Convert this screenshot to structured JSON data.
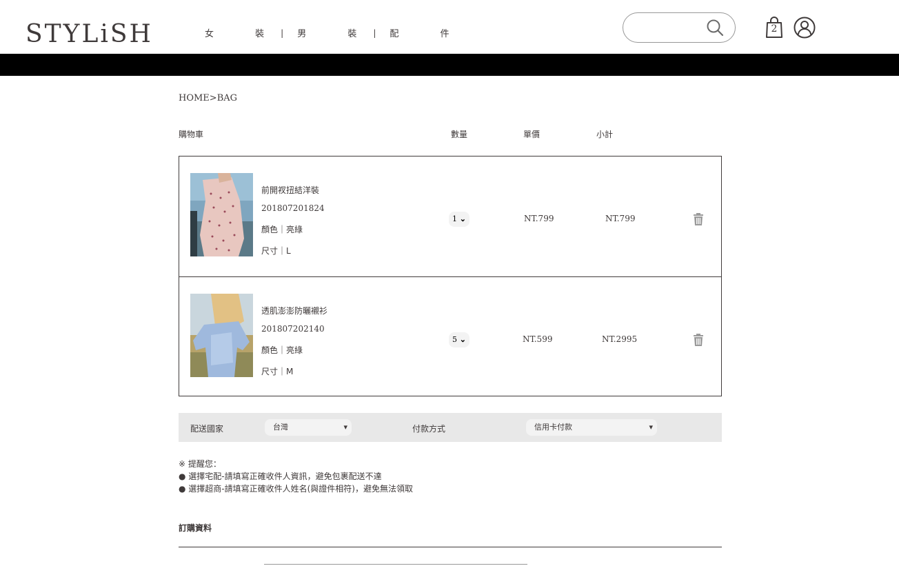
{
  "header": {
    "logo": "STYLiSH",
    "nav": [
      "女 裝",
      "男 裝",
      "配 件"
    ],
    "nav_sep": "|",
    "search_placeholder": "",
    "cart_count": "2"
  },
  "breadcrumb": "HOME>BAG",
  "cart_headers": {
    "title": "購物車",
    "qty": "數量",
    "unit_price": "單價",
    "subtotal": "小計"
  },
  "cart_items": [
    {
      "name": "前開衩扭結洋裝",
      "id": "201807201824",
      "color": "顏色｜亮綠",
      "size": "尺寸｜L",
      "qty": "1",
      "price": "NT.799",
      "subtotal": "NT.799"
    },
    {
      "name": "透肌澎澎防曬襯衫",
      "id": "201807202140",
      "color": "顏色｜亮綠",
      "size": "尺寸｜M",
      "qty": "5",
      "price": "NT.599",
      "subtotal": "NT.2995"
    }
  ],
  "shipping": {
    "country_label": "配送國家",
    "country_value": "台灣",
    "payment_label": "付款方式",
    "payment_value": "信用卡付款"
  },
  "notes": [
    "※ 提醒您：",
    "● 選擇宅配-請填寫正確收件人資訊，避免包裹配送不達",
    "● 選擇超商-請填寫正確收件人姓名(與證件相符)，避免無法領取"
  ],
  "order_title": "訂購資料"
}
